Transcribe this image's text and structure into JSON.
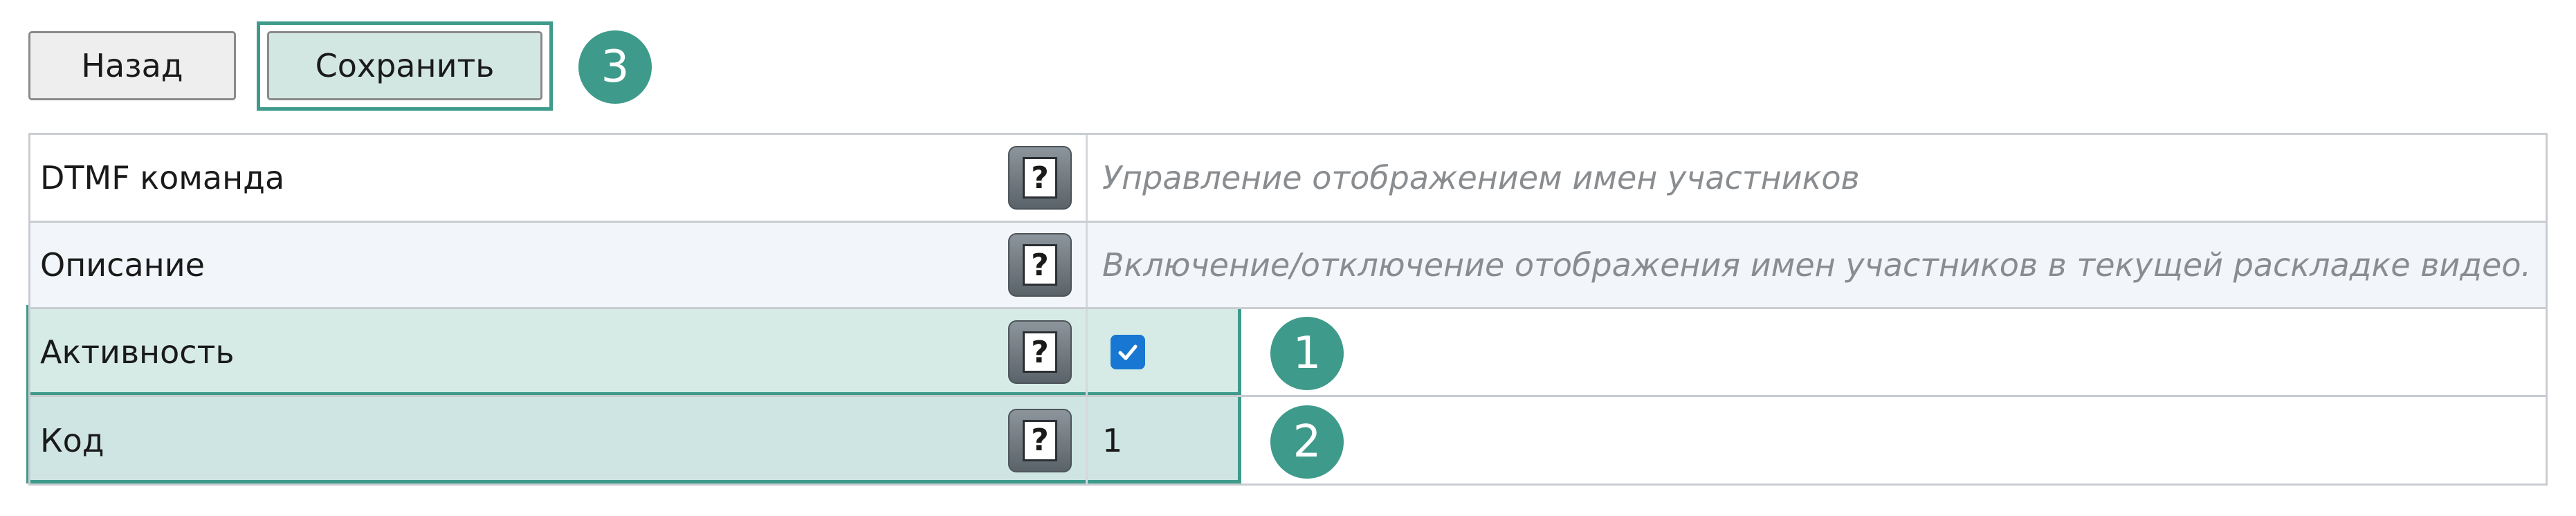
{
  "toolbar": {
    "back_label": "Назад",
    "save_label": "Сохранить",
    "save_badge": "3"
  },
  "table": {
    "rows": [
      {
        "label": "DTMF команда",
        "help": "?",
        "value": "Управление отображением имен участников"
      },
      {
        "label": "Описание",
        "help": "?",
        "value": "Включение/отключение отображения имен участников в текущей раскладке видео."
      },
      {
        "label": "Активность",
        "help": "?",
        "checked": true,
        "badge": "1"
      },
      {
        "label": "Код",
        "help": "?",
        "value": "1",
        "badge": "2"
      }
    ]
  },
  "colors": {
    "accent": "#3e9b8b",
    "highlight_active": "#d6ebe6",
    "highlight_code": "#cfe5e4",
    "checkbox": "#1877d2",
    "row_alt": "#f2f5f9"
  }
}
